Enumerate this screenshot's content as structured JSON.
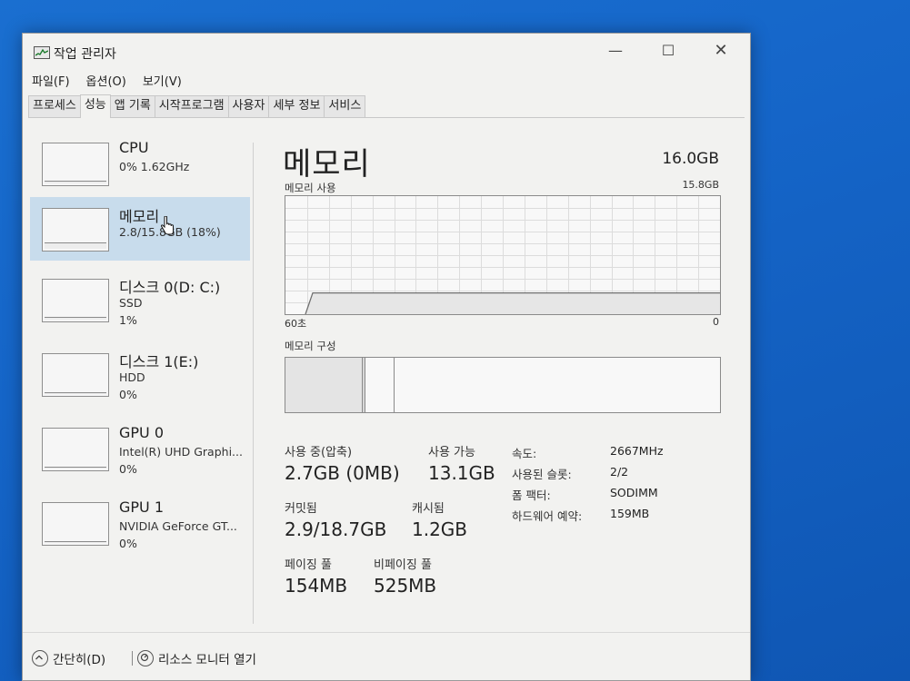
{
  "window": {
    "title": "작업 관리자",
    "controls": {
      "minimize": "—",
      "maximize": "☐",
      "close": "✕"
    }
  },
  "menu": [
    "파일(F)",
    "옵션(O)",
    "보기(V)"
  ],
  "tabs": [
    {
      "label": "프로세스",
      "active": false
    },
    {
      "label": "성능",
      "active": true
    },
    {
      "label": "앱 기록",
      "active": false
    },
    {
      "label": "시작프로그램",
      "active": false
    },
    {
      "label": "사용자",
      "active": false
    },
    {
      "label": "세부 정보",
      "active": false
    },
    {
      "label": "서비스",
      "active": false
    }
  ],
  "sidebar": [
    {
      "name": "CPU",
      "sub": "0% 1.62GHz",
      "sub2": "",
      "selected": false
    },
    {
      "name": "메모리",
      "sub": "2.8/15.8GB (18%)",
      "sub2": "",
      "selected": true
    },
    {
      "name": "디스크 0(D: C:)",
      "sub": "SSD",
      "sub2": "1%",
      "selected": false
    },
    {
      "name": "디스크 1(E:)",
      "sub": "HDD",
      "sub2": "0%",
      "selected": false
    },
    {
      "name": "GPU 0",
      "sub": "Intel(R) UHD Graphi...",
      "sub2": "0%",
      "selected": false
    },
    {
      "name": "GPU 1",
      "sub": "NVIDIA GeForce GT...",
      "sub2": "0%",
      "selected": false
    }
  ],
  "main": {
    "title": "메모리",
    "total": "16.0GB",
    "usage_label": "메모리 사용",
    "usage_max": "15.8GB",
    "axis_left": "60초",
    "axis_right": "0",
    "composition_label": "메모리 구성",
    "usage_fraction": 0.18,
    "stats": {
      "in_use_label": "사용 중(압축)",
      "in_use_value": "2.7GB (0MB)",
      "available_label": "사용 가능",
      "available_value": "13.1GB",
      "committed_label": "커밋됨",
      "committed_value": "2.9/18.7GB",
      "cached_label": "캐시됨",
      "cached_value": "1.2GB",
      "paged_label": "페이징 풀",
      "paged_value": "154MB",
      "nonpaged_label": "비페이징 풀",
      "nonpaged_value": "525MB"
    },
    "specs": [
      {
        "label": "속도:",
        "value": "2667MHz"
      },
      {
        "label": "사용된 슬롯:",
        "value": "2/2"
      },
      {
        "label": "폼 팩터:",
        "value": "SODIMM"
      },
      {
        "label": "하드웨어 예약:",
        "value": "159MB"
      }
    ]
  },
  "bottom": {
    "fewer_details": "간단히(D)",
    "resource_monitor": "리소스 모니터 열기"
  }
}
